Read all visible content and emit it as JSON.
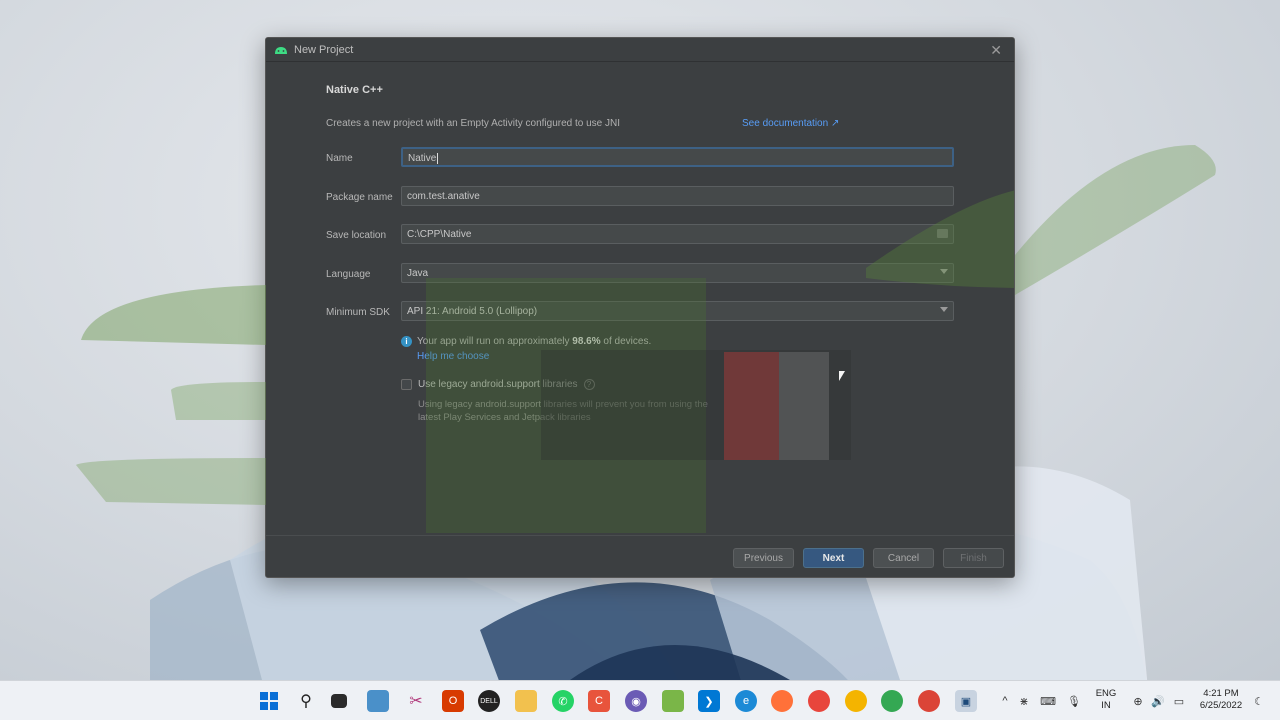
{
  "dialog": {
    "title": "New Project",
    "heading": "Native C++",
    "description": "Creates a new project with an Empty Activity configured to use JNI",
    "doc_link": "See documentation ↗",
    "fields": {
      "name_label": "Name",
      "name_value": "Native",
      "package_label": "Package name",
      "package_value": "com.test.anative",
      "save_label": "Save location",
      "save_value": "C:\\CPP\\Native",
      "language_label": "Language",
      "language_value": "Java",
      "sdk_label": "Minimum SDK",
      "sdk_value": "API 21: Android 5.0 (Lollipop)"
    },
    "info": {
      "prefix": "Your app will run on approximately",
      "percent": "98.6%",
      "suffix": "of devices.",
      "help_link": "Help me choose"
    },
    "legacy": {
      "label": "Use legacy android.support libraries",
      "description": "Using legacy android.support libraries will prevent you from using the latest Play Services and Jetpack libraries"
    },
    "buttons": {
      "previous": "Previous",
      "next": "Next",
      "cancel": "Cancel",
      "finish": "Finish"
    }
  },
  "taskbar": {
    "lang_top": "ENG",
    "lang_bottom": "IN",
    "time": "4:21 PM",
    "date": "6/25/2022"
  },
  "colors": {
    "dialog_bg": "#3c3f41",
    "link": "#589df6",
    "primary_button": "#365880",
    "focus_border": "#3d6185"
  }
}
